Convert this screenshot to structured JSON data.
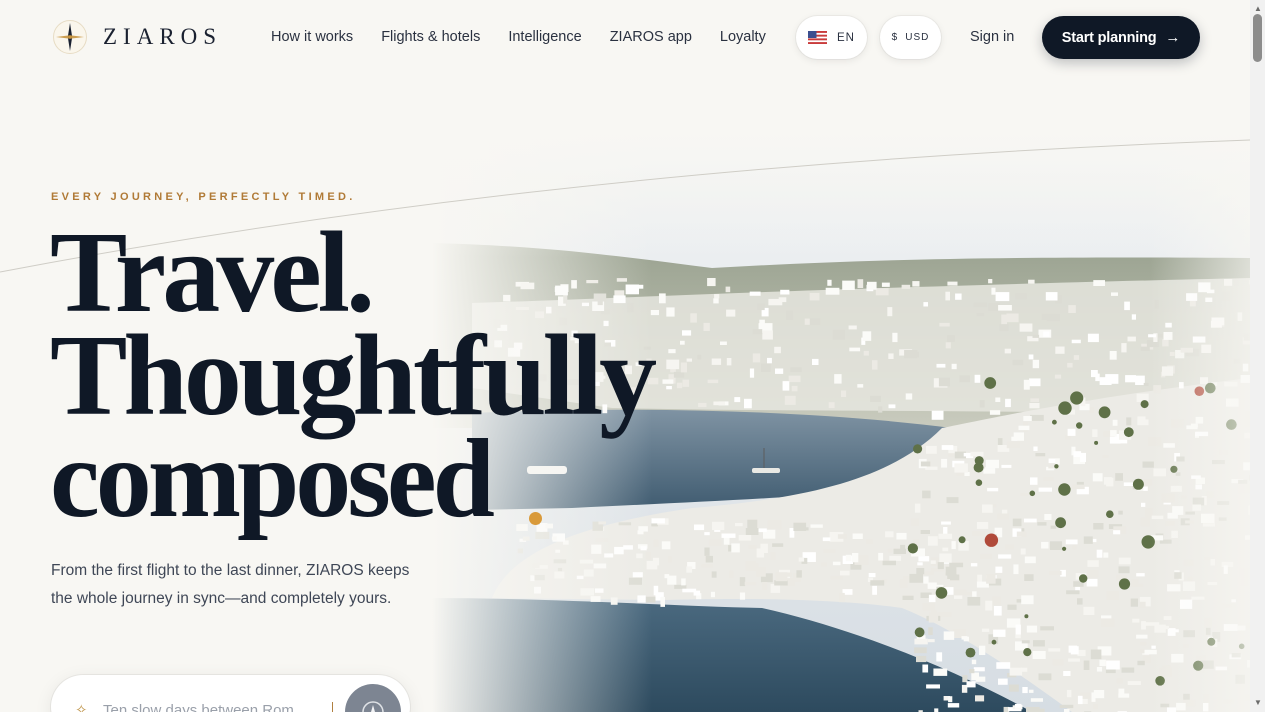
{
  "brand": {
    "name": "ZIAROS"
  },
  "nav": [
    {
      "label": "How it works"
    },
    {
      "label": "Flights & hotels"
    },
    {
      "label": "Intelligence"
    },
    {
      "label": "ZIAROS app"
    },
    {
      "label": "Loyalty"
    }
  ],
  "locale": {
    "language": "EN",
    "currency_symbol": "$",
    "currency": "USD"
  },
  "auth": {
    "sign_in": "Sign in"
  },
  "cta": {
    "label": "Start planning",
    "arrow": "→"
  },
  "hero": {
    "eyebrow": "EVERY JOURNEY, PERFECTLY TIMED.",
    "headline": [
      "Travel.",
      "Thoughtfully",
      "composed"
    ],
    "lede": "From the first flight to the last dinner, ZIAROS keeps the whole journey in sync—and completely yours."
  },
  "search": {
    "placeholder": "Ten slow days between Rom",
    "spark_icon": "sparkle-icon",
    "submit_icon": "compass-icon"
  },
  "colors": {
    "accent": "#b07a36",
    "ink": "#0f1826",
    "background": "#f8f7f3"
  }
}
